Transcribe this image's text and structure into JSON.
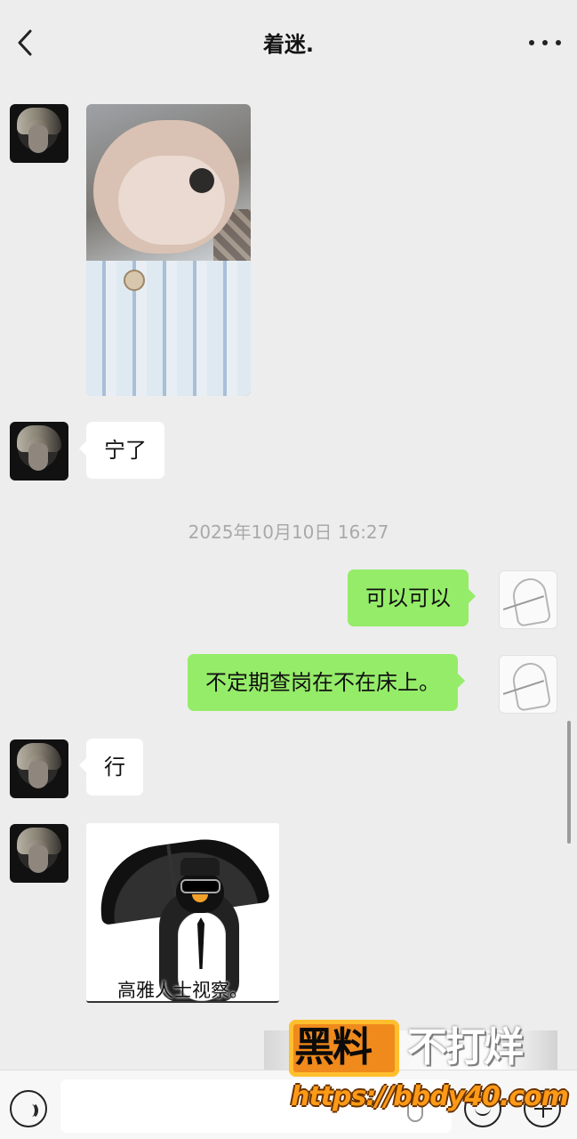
{
  "header": {
    "title": "着迷."
  },
  "messages": {
    "left_1_text": "宁了",
    "timestamp": "2025年10月10日 16:27",
    "right_1_text": "可以可以",
    "right_2_text": "不定期查岗在不在床上。",
    "left_2_text": "行",
    "sticker_caption": "高雅人士视察。"
  },
  "watermark": {
    "left_text": "黑料",
    "right_text": "不打烊",
    "url": "https://bbdy40.com"
  },
  "icons": {
    "back": "back-chevron-icon",
    "more": "more-dots-icon",
    "voice": "voice-icon",
    "emoji": "emoji-icon",
    "plus": "plus-icon"
  },
  "colors": {
    "background": "#ededed",
    "sent_bubble": "#95ec69",
    "received_bubble": "#ffffff",
    "timestamp": "#a9a9a9"
  }
}
